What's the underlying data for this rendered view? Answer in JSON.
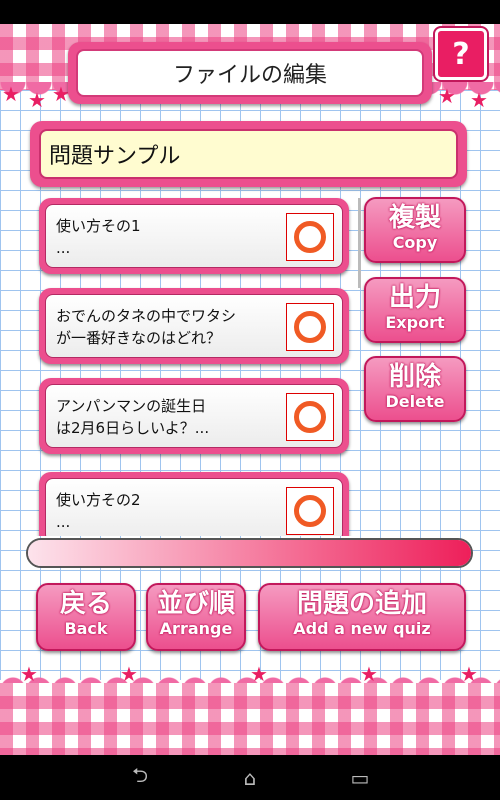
{
  "window": {
    "title": "ファイルの編集",
    "help_label": "?"
  },
  "file": {
    "name": "問題サンプル"
  },
  "items": [
    {
      "text": "使い方その1\n...",
      "mark": "ring-icon"
    },
    {
      "text": "おでんのタネの中でワタシ\nが一番好きなのはどれ？",
      "mark": "ring-icon"
    },
    {
      "text": "アンパンマンの誕生日\nは2月6日らしいよ？...",
      "mark": "ring-icon"
    },
    {
      "text": "使い方その2\n...",
      "mark": "ring-icon"
    }
  ],
  "side_buttons": [
    {
      "jp": "複製",
      "en": "Copy"
    },
    {
      "jp": "出力",
      "en": "Export"
    },
    {
      "jp": "削除",
      "en": "Delete"
    }
  ],
  "progress": {
    "fraction": 1.0
  },
  "bottom_buttons": [
    {
      "jp": "戻る",
      "en": "Back"
    },
    {
      "jp": "並び順",
      "en": "Arrange"
    },
    {
      "jp": "問題の追加",
      "en": "Add a new quiz"
    }
  ],
  "nav": {
    "back": "⮌",
    "home": "⌂",
    "recents": "▭"
  },
  "colors": {
    "accent": "#ec4f8e",
    "mark": "#f05a24",
    "grid": "#9fc4ef",
    "name_bg": "#fffcd0"
  }
}
